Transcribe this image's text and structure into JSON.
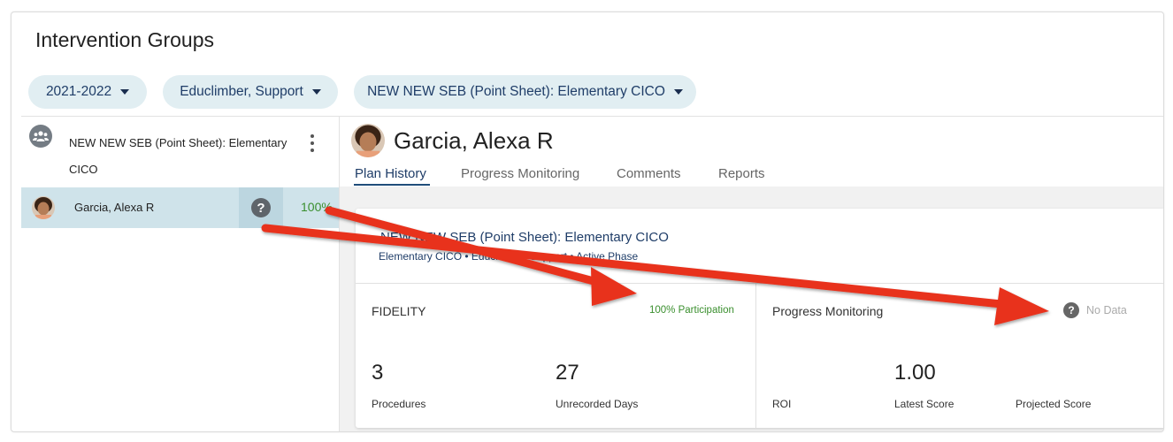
{
  "page_title": "Intervention Groups",
  "filters": [
    {
      "label": "2021-2022"
    },
    {
      "label": "Educlimber, Support"
    },
    {
      "label": "NEW NEW SEB (Point Sheet): Elementary CICO"
    }
  ],
  "group": {
    "name": "NEW NEW SEB (Point Sheet): Elementary CICO",
    "icon": "group-icon"
  },
  "students": [
    {
      "name": "Garcia, Alexa R",
      "status_icon": "question-icon",
      "percent": "100%"
    }
  ],
  "detail": {
    "student_name": "Garcia, Alexa R",
    "tabs": [
      {
        "label": "Plan History",
        "active": true
      },
      {
        "label": "Progress Monitoring",
        "active": false
      },
      {
        "label": "Comments",
        "active": false
      },
      {
        "label": "Reports",
        "active": false
      }
    ],
    "plan": {
      "title": "NEW NEW SEB (Point Sheet): Elementary CICO",
      "meta": "Elementary CICO  •  Educlimber, Support  •  Active Phase"
    },
    "fidelity": {
      "title": "FIDELITY",
      "badge": "100% Participation",
      "stats": [
        {
          "value": "3",
          "label": "Procedures"
        },
        {
          "value": "27",
          "label": "Unrecorded Days"
        }
      ]
    },
    "progress": {
      "title": "Progress Monitoring",
      "status": "No Data",
      "stats": [
        {
          "value": "",
          "label": "ROI"
        },
        {
          "value": "1.00",
          "label": "Latest Score"
        },
        {
          "value": "",
          "label": "Projected Score"
        }
      ]
    }
  },
  "colors": {
    "accent": "#1f3d68",
    "chip_bg": "#e1eef2",
    "selected_row": "#cfe3ea",
    "success": "#3a8f2e",
    "annotation_arrow": "#e8321f"
  }
}
